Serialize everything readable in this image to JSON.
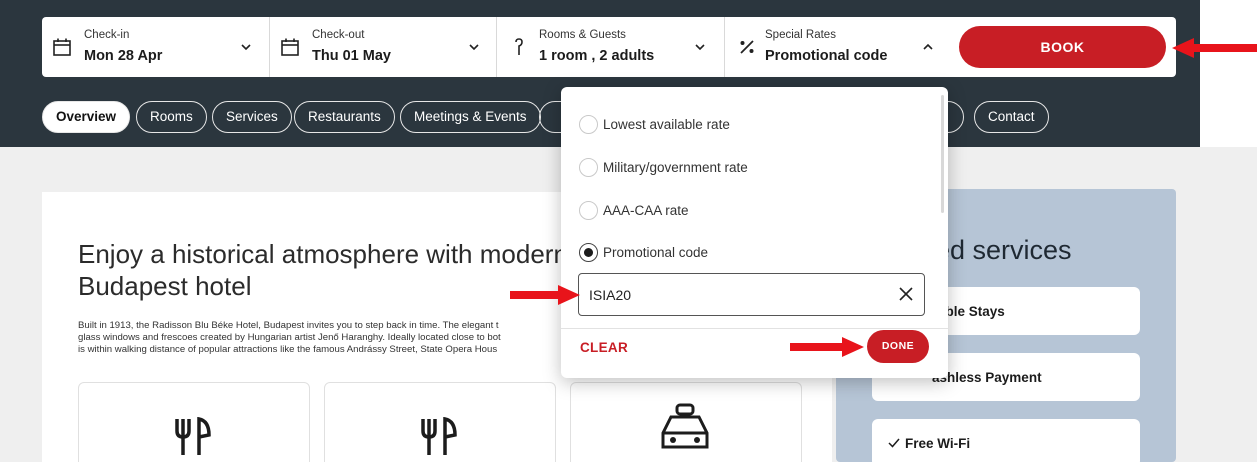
{
  "booking": {
    "checkin": {
      "label": "Check-in",
      "value": "Mon 28 Apr",
      "icon": "calendar-icon"
    },
    "checkout": {
      "label": "Check-out",
      "value": "Thu 01 May",
      "icon": "calendar-icon"
    },
    "rooms": {
      "label": "Rooms & Guests",
      "value": "1 room , 2 adults",
      "icon": "person-icon"
    },
    "rates": {
      "label": "Special Rates",
      "value": "Promotional code",
      "icon": "percent-icon"
    },
    "book_label": "BOOK"
  },
  "tabs": [
    {
      "label": "Overview",
      "active": true
    },
    {
      "label": "Rooms"
    },
    {
      "label": "Services"
    },
    {
      "label": "Restaurants"
    },
    {
      "label": "Meetings & Events"
    },
    {
      "label": "Contact"
    }
  ],
  "content": {
    "headline": "Enjoy a historical atmosphere with modern\nBudapest hotel",
    "body": "Built in 1913, the Radisson Blu Béke Hotel, Budapest invites you to step back in time. The elegant t\nglass windows and frescoes created by Hungarian artist Jenő Haranghy. Ideally located close to bot\nis within walking distance of popular attractions like the famous Andrássy Street, State Opera Hous",
    "cards": [
      {
        "icon": "restaurant-icon"
      },
      {
        "icon": "restaurant-icon"
      },
      {
        "icon": "taxi-icon"
      }
    ]
  },
  "panel": {
    "title": "ed services",
    "services": [
      "able Stays",
      "ashless Payment",
      "Free Wi-Fi"
    ]
  },
  "dropdown": {
    "options": [
      {
        "label": "Lowest available rate",
        "selected": false
      },
      {
        "label": "Military/government rate",
        "selected": false
      },
      {
        "label": "AAA-CAA rate",
        "selected": false
      },
      {
        "label": "Promotional code",
        "selected": true
      }
    ],
    "promo_value": "ISIA20",
    "clear_label": "CLEAR",
    "done_label": "DONE"
  },
  "colors": {
    "brand_red": "#c81e25",
    "header_dark": "#2b363e",
    "panel_blue": "#b6c5d6",
    "arrow_red": "#e8141b"
  }
}
